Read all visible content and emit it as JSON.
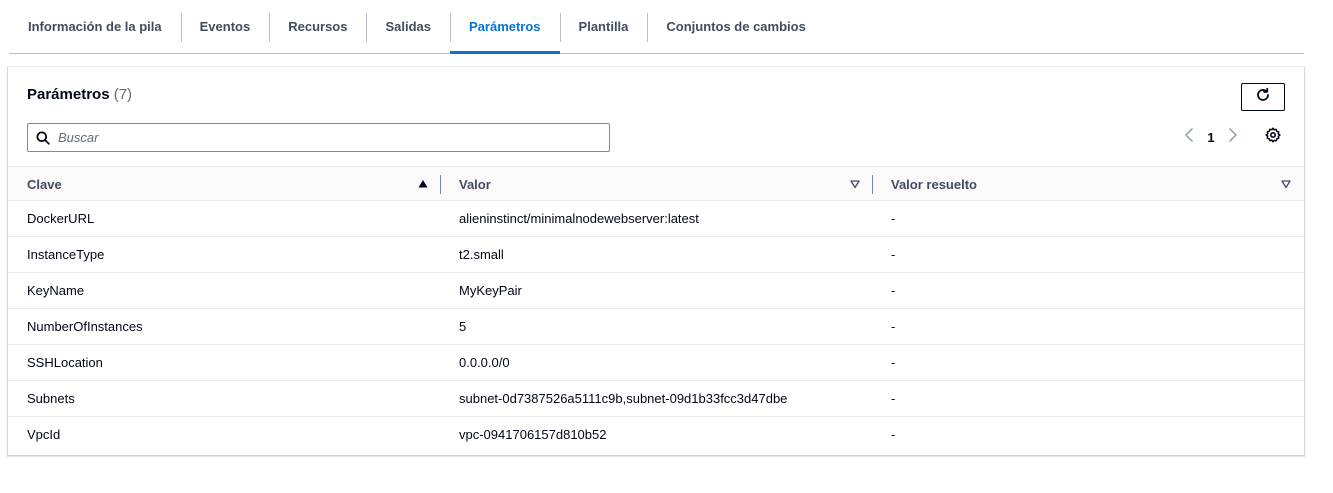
{
  "tabs": [
    {
      "label": "Información de la pila",
      "active": false
    },
    {
      "label": "Eventos",
      "active": false
    },
    {
      "label": "Recursos",
      "active": false
    },
    {
      "label": "Salidas",
      "active": false
    },
    {
      "label": "Parámetros",
      "active": true
    },
    {
      "label": "Plantilla",
      "active": false
    },
    {
      "label": "Conjuntos de cambios",
      "active": false
    }
  ],
  "panel": {
    "title": "Parámetros",
    "count": "(7)"
  },
  "search": {
    "value": "",
    "placeholder": "Buscar"
  },
  "pagination": {
    "current_page": "1"
  },
  "table": {
    "columns": [
      "Clave",
      "Valor",
      "Valor resuelto"
    ],
    "sorted_column": "Clave",
    "sort_direction": "ascending",
    "rows": [
      {
        "key": "DockerURL",
        "value": "alieninstinct/minimalnodewebserver:latest",
        "resolved": "-"
      },
      {
        "key": "InstanceType",
        "value": "t2.small",
        "resolved": "-"
      },
      {
        "key": "KeyName",
        "value": "MyKeyPair",
        "resolved": "-"
      },
      {
        "key": "NumberOfInstances",
        "value": "5",
        "resolved": "-"
      },
      {
        "key": "SSHLocation",
        "value": "0.0.0.0/0",
        "resolved": "-"
      },
      {
        "key": "Subnets",
        "value": "subnet-0d7387526a5111c9b,subnet-09d1b33fcc3d47dbe",
        "resolved": "-"
      },
      {
        "key": "VpcId",
        "value": "vpc-0941706157d810b52",
        "resolved": "-"
      }
    ]
  },
  "icons": {
    "refresh": "refresh-icon",
    "search": "search-icon",
    "prev": "chevron-left-icon",
    "next": "chevron-right-icon",
    "settings": "gear-icon",
    "sort_asc": "caret-up-filled-icon",
    "sort_none": "caret-down-icon"
  },
  "colors": {
    "accent": "#0972d3",
    "text": "#000716",
    "muted": "#5f6b7a",
    "tab_text": "#414d5c",
    "border": "#b6bec9"
  }
}
